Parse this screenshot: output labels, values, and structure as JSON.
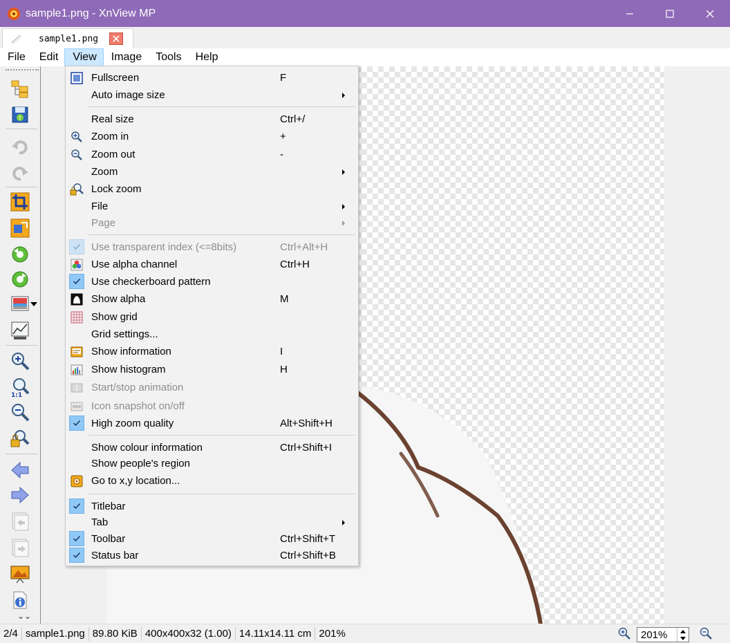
{
  "window": {
    "title": "sample1.png - XnView MP",
    "minimize": "—",
    "maximize": "☐",
    "close": "✕",
    "titlebar_color": "#8e6ab8"
  },
  "tab": {
    "label": "sample1.png"
  },
  "menubar": {
    "items": [
      {
        "label": "File"
      },
      {
        "label": "Edit"
      },
      {
        "label": "View"
      },
      {
        "label": "Image"
      },
      {
        "label": "Tools"
      },
      {
        "label": "Help"
      }
    ],
    "active": "View"
  },
  "view_menu": {
    "items": [
      {
        "label": "Fullscreen",
        "shortcut": "F",
        "icon": "fullscreen-icon"
      },
      {
        "label": "Auto image size",
        "shortcut": "",
        "submenu": true
      },
      {
        "label": "Real size",
        "shortcut": "Ctrl+/"
      },
      {
        "label": "Zoom in",
        "shortcut": "+",
        "icon": "zoom-in-icon"
      },
      {
        "label": "Zoom out",
        "shortcut": "-",
        "icon": "zoom-out-icon"
      },
      {
        "label": "Zoom",
        "shortcut": "",
        "submenu": true
      },
      {
        "label": "Lock zoom",
        "shortcut": "",
        "icon": "lock-zoom-icon"
      },
      {
        "label": "File",
        "shortcut": "",
        "submenu": true
      },
      {
        "label": "Page",
        "shortcut": "",
        "submenu": true,
        "disabled": true
      },
      {
        "label": "Use transparent index (<=8bits)",
        "shortcut": "Ctrl+Alt+H",
        "checked": true,
        "disabled": true
      },
      {
        "label": "Use alpha channel",
        "shortcut": "Ctrl+H",
        "icon": "alpha-channel-icon"
      },
      {
        "label": "Use checkerboard pattern",
        "shortcut": "",
        "checked": true
      },
      {
        "label": "Show alpha",
        "shortcut": "M",
        "icon": "show-alpha-icon"
      },
      {
        "label": "Show grid",
        "shortcut": "",
        "icon": "grid-icon"
      },
      {
        "label": "Grid settings...",
        "shortcut": ""
      },
      {
        "label": "Show information",
        "shortcut": "I",
        "icon": "information-icon"
      },
      {
        "label": "Show histogram",
        "shortcut": "H",
        "icon": "histogram-icon"
      },
      {
        "label": "Start/stop animation",
        "shortcut": "",
        "icon": "animation-icon",
        "disabled": true
      },
      {
        "label": "Icon snapshot on/off",
        "shortcut": "",
        "icon": "snapshot-icon",
        "disabled": true
      },
      {
        "label": "High zoom quality",
        "shortcut": "Alt+Shift+H",
        "checked": true
      },
      {
        "label": "Show colour information",
        "shortcut": "Ctrl+Shift+I"
      },
      {
        "label": "Show people's region",
        "shortcut": ""
      },
      {
        "label": "Go to x,y location...",
        "shortcut": "",
        "icon": "goto-location-icon"
      },
      {
        "label": "Titlebar",
        "shortcut": "",
        "checked": true
      },
      {
        "label": "Tab",
        "shortcut": "",
        "submenu": true
      },
      {
        "label": "Toolbar",
        "shortcut": "Ctrl+Shift+T",
        "checked": true
      },
      {
        "label": "Status bar",
        "shortcut": "Ctrl+Shift+B",
        "checked": true
      }
    ]
  },
  "toolbar": {
    "buttons": [
      {
        "icon": "browse-folder-icon"
      },
      {
        "icon": "save-icon"
      },
      {
        "icon": "undo-icon",
        "disabled": true
      },
      {
        "icon": "redo-icon",
        "disabled": true
      },
      {
        "icon": "crop-icon"
      },
      {
        "icon": "resize-icon"
      },
      {
        "icon": "rotate-left-icon"
      },
      {
        "icon": "rotate-right-icon"
      },
      {
        "icon": "adjust-colors-icon"
      },
      {
        "icon": "levels-icon"
      },
      {
        "icon": "zoom-in-icon"
      },
      {
        "icon": "actual-size-icon"
      },
      {
        "icon": "zoom-out-icon"
      },
      {
        "icon": "lock-zoom-icon"
      },
      {
        "icon": "previous-icon"
      },
      {
        "icon": "next-icon"
      },
      {
        "icon": "first-page-icon",
        "disabled": true
      },
      {
        "icon": "last-page-icon",
        "disabled": true
      },
      {
        "icon": "slideshow-icon"
      },
      {
        "icon": "properties-icon"
      }
    ],
    "more": "⌄⌄"
  },
  "statusbar": {
    "position": "2/4",
    "filename": "sample1.png",
    "filesize": "89.80 KiB",
    "dimensions": "400x400x32 (1.00)",
    "print_size": "14.11x14.11 cm",
    "zoom_percent": "201%",
    "zoom_value": "201%"
  },
  "colors": {
    "menu_highlight": "#cce8ff",
    "check_background": "#90c8f6",
    "tab_close": "#f07c6c"
  }
}
